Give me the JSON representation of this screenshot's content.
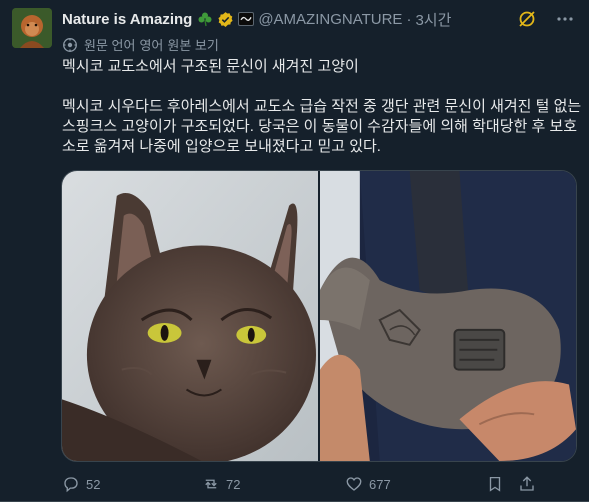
{
  "tweet": {
    "display_name": "Nature is Amazing",
    "handle": "@AMAZINGNATURE",
    "separator": "·",
    "time": "3시간",
    "translate": {
      "original_language": "원문 언어",
      "language": "영어",
      "show_original": "원본 보기"
    },
    "title": "멕시코 교도소에서 구조된 문신이 새겨진 고양이",
    "body_line1": "멕시코 시우다드 후아레스에서 교도소 급습 작전 중 갱단 관련 문신이 새겨진 털 없는",
    "body_line2": "스핑크스 고양이가 구조되었다. 당국은 이 동물이 수감자들에 의해 학대당한 후 보호",
    "body_line3": "소로 옮겨져 나중에 입양으로 보내졌다고 믿고 있다."
  },
  "actions": {
    "replies": "52",
    "reposts": "72",
    "likes": "677"
  },
  "icons": {
    "emoji": "shamrock-icon",
    "verified": "verified-badge-icon",
    "affiliate": "affiliate-badge-icon",
    "grok": "grok-icon",
    "more": "more-icon",
    "translate": "translate-icon",
    "reply": "reply-icon",
    "repost": "repost-icon",
    "like": "heart-icon",
    "bookmark": "bookmark-icon",
    "share": "share-icon"
  },
  "colors": {
    "background": "#15202b",
    "text": "#e7e9ea",
    "muted": "#8b98a5",
    "verified_gold": "#e2b719",
    "border": "#38444d"
  }
}
